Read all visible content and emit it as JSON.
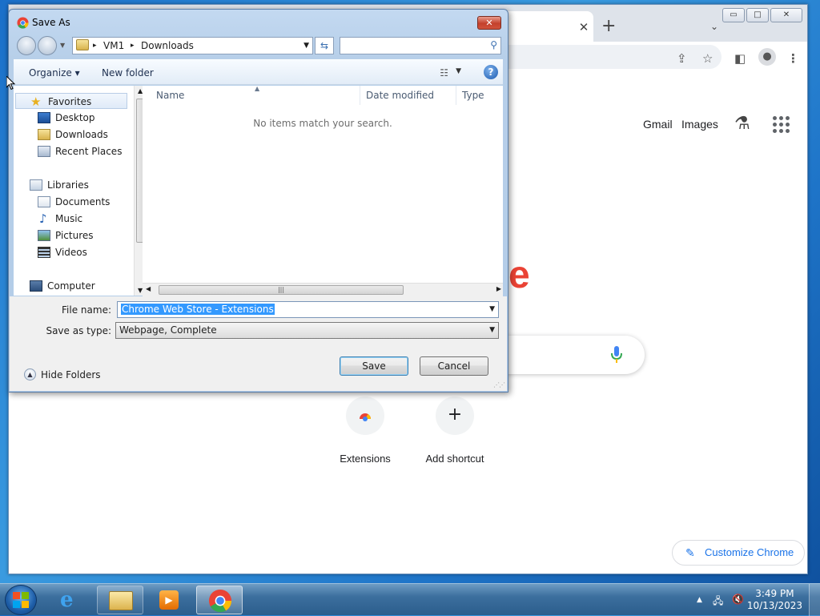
{
  "chrome": {
    "tab_close": "✕",
    "new_tab": "+",
    "tab_dropdown": "⌄",
    "window_controls": [
      "▭",
      "□",
      "✕"
    ],
    "links": {
      "gmail": "Gmail",
      "images": "Images"
    },
    "shortcuts": [
      {
        "label": "Extensions"
      },
      {
        "label": "Add shortcut",
        "glyph": "+"
      }
    ],
    "customize_label": "Customize Chrome",
    "logo_fragment": "e"
  },
  "dialog": {
    "title": "Save As",
    "close_glyph": "✕",
    "breadcrumb": [
      "VM1",
      "Downloads"
    ],
    "breadcrumb_sep": "▸",
    "toolbar": {
      "organize": "Organize ▾",
      "new_folder": "New folder",
      "help": "?"
    },
    "nav": {
      "favorites": "Favorites",
      "desktop": "Desktop",
      "downloads": "Downloads",
      "recent_places": "Recent Places",
      "libraries": "Libraries",
      "documents": "Documents",
      "music": "Music",
      "pictures": "Pictures",
      "videos": "Videos",
      "computer": "Computer"
    },
    "columns": {
      "name": "Name",
      "date_modified": "Date modified",
      "type": "Type"
    },
    "empty_message": "No items match your search.",
    "file_name_label": "File name:",
    "file_name_value": "Chrome Web Store - Extensions",
    "save_type_label": "Save as type:",
    "save_type_value": "Webpage, Complete",
    "save_button": "Save",
    "cancel_button": "Cancel",
    "hide_folders": "Hide Folders"
  },
  "taskbar": {
    "time": "3:49 PM",
    "date": "10/13/2023"
  },
  "colors": {
    "chrome_blue": "#1a73e8",
    "selection_blue": "#3399ff",
    "close_red": "#c4412c"
  }
}
